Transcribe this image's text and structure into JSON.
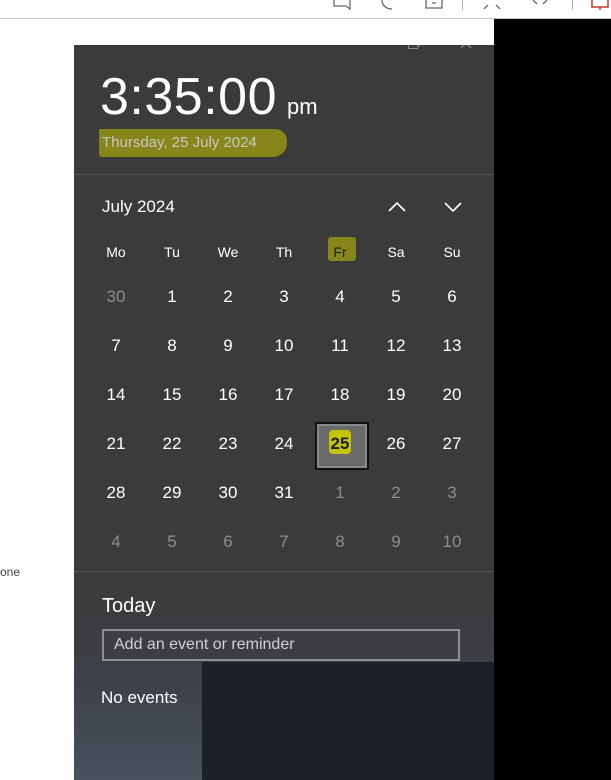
{
  "clock": {
    "time": "3:35:00",
    "ampm": "pm",
    "date_long": "Thursday, 25 July 2024"
  },
  "calendar": {
    "month_title": "July 2024",
    "weekdays": [
      "Mo",
      "Tu",
      "We",
      "Th",
      "Fr",
      "Sa",
      "Su"
    ],
    "weeks": [
      [
        "30",
        "1",
        "2",
        "3",
        "4",
        "5",
        "6"
      ],
      [
        "7",
        "8",
        "9",
        "10",
        "11",
        "12",
        "13"
      ],
      [
        "14",
        "15",
        "16",
        "17",
        "18",
        "19",
        "20"
      ],
      [
        "21",
        "22",
        "23",
        "24",
        "25",
        "26",
        "27"
      ],
      [
        "28",
        "29",
        "30",
        "31",
        "1",
        "2",
        "3"
      ],
      [
        "4",
        "5",
        "6",
        "7",
        "8",
        "9",
        "10"
      ]
    ],
    "today": "25",
    "highlight_color": "#c4c400"
  },
  "agenda": {
    "title": "Today",
    "event_placeholder": "Add an event or reminder",
    "no_events": "No events"
  },
  "background": {
    "left_text": "one"
  },
  "icons": [
    "minimize-icon",
    "restore-icon",
    "close-icon",
    "chevron-up-icon",
    "chevron-down-icon"
  ]
}
